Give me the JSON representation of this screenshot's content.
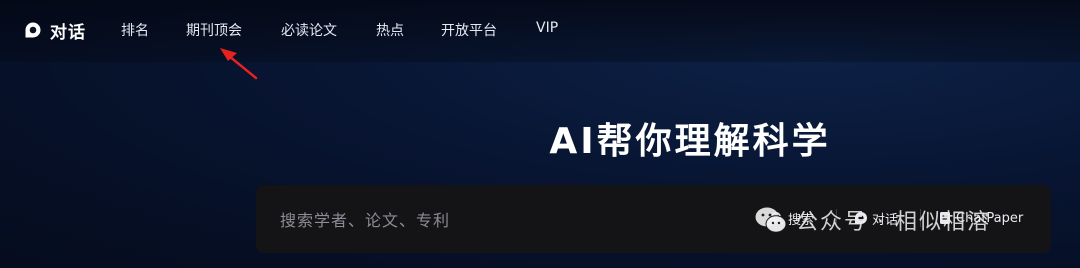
{
  "nav": {
    "brand_label": "对话",
    "items": [
      {
        "label": "排名"
      },
      {
        "label": "期刊顶会"
      },
      {
        "label": "必读论文"
      },
      {
        "label": "热点"
      },
      {
        "label": "开放平台"
      },
      {
        "label": "VIP"
      }
    ]
  },
  "hero": {
    "title": "AI帮你理解科学"
  },
  "search": {
    "placeholder": "搜索学者、论文、专利",
    "buttons": {
      "search_label": "搜索",
      "chat_label": "对话",
      "chatpaper_label": "ChatPaper"
    }
  },
  "watermark": {
    "text": "公众号 · 相似相溶"
  },
  "colors": {
    "background": "#081634",
    "search_box": "#141416",
    "arrow": "#e8231f",
    "text": "#ffffff"
  },
  "icons": [
    "chat-bubble-icon",
    "search-icon",
    "red-arrow-annotation",
    "wechat-logo-icon"
  ]
}
